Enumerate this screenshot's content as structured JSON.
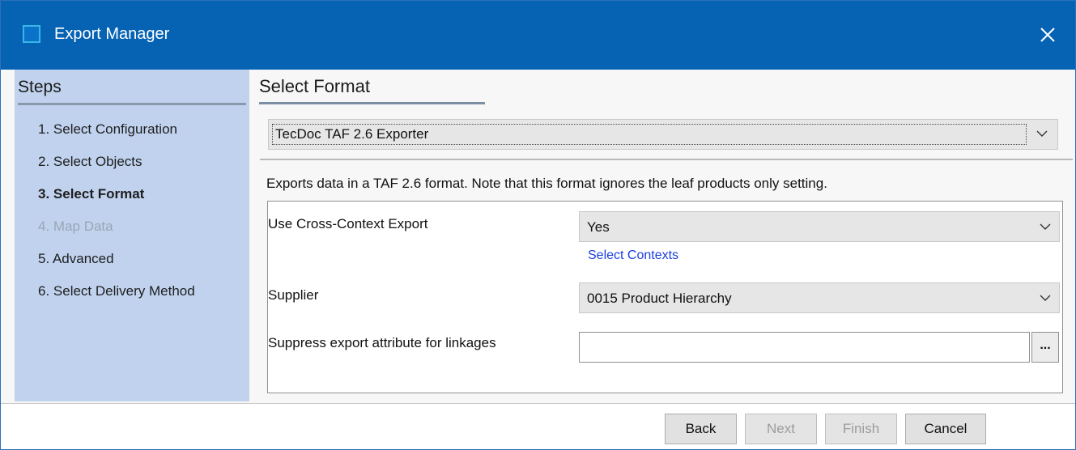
{
  "window": {
    "title": "Export Manager",
    "title_bar_color": "#0663b4"
  },
  "steps": {
    "heading": "Steps",
    "items": [
      {
        "label": "1. Select Configuration",
        "state": "normal"
      },
      {
        "label": "2. Select Objects",
        "state": "normal"
      },
      {
        "label": "3. Select Format",
        "state": "active"
      },
      {
        "label": "4. Map Data",
        "state": "disabled"
      },
      {
        "label": "5. Advanced",
        "state": "normal"
      },
      {
        "label": "6. Select Delivery Method",
        "state": "normal"
      }
    ]
  },
  "format": {
    "section_title": "Select Format",
    "selected": "TecDoc TAF 2.6 Exporter",
    "description": "Exports data in a TAF 2.6 format. Note that this format ignores the leaf products only setting."
  },
  "options": {
    "cross_context": {
      "label": "Use Cross-Context Export",
      "value": "Yes",
      "link": "Select Contexts"
    },
    "supplier": {
      "label": "Supplier",
      "value": "0015 Product Hierarchy"
    },
    "suppress": {
      "label": "Suppress export attribute for linkages",
      "value": "",
      "browse_label": "..."
    }
  },
  "footer": {
    "back": "Back",
    "next": "Next",
    "finish": "Finish",
    "cancel": "Cancel"
  },
  "icons": {
    "app": "window-icon",
    "close": "close-icon",
    "dropdown": "chevron-down-icon"
  }
}
